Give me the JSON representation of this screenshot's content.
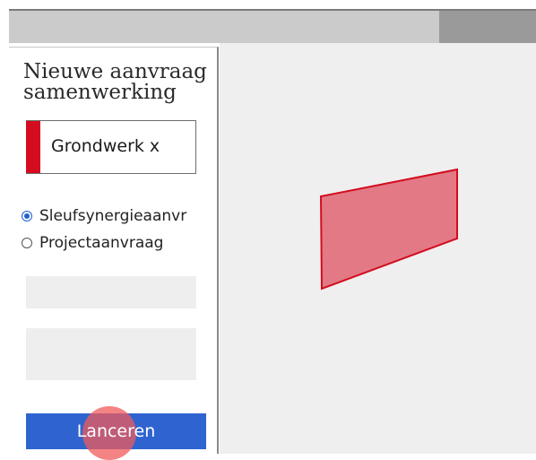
{
  "panel": {
    "title": "Nieuwe aanvraag samenwerking",
    "name_value": "Grondwerk x",
    "radio_options": [
      {
        "label": "Sleufsynergieaanvr",
        "checked": true
      },
      {
        "label": "Projectaanvraag",
        "checked": false
      }
    ],
    "launch_label": "Lanceren"
  },
  "colors": {
    "accent_red": "#d30c1f",
    "button_blue": "#2f64d0",
    "polygon_fill": "#e06b78"
  }
}
